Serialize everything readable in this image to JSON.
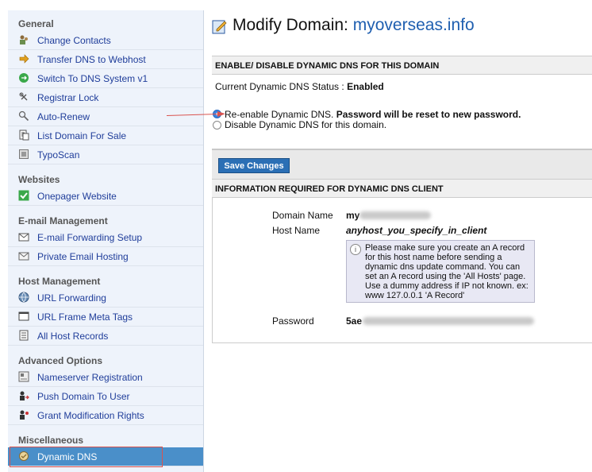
{
  "sidebar": {
    "sections": [
      {
        "title": "General",
        "items": [
          {
            "label": "Change Contacts",
            "icon": "contacts-icon"
          },
          {
            "label": "Transfer DNS to Webhost",
            "icon": "arrow-right-icon"
          },
          {
            "label": "Switch To DNS System v1",
            "icon": "switch-icon"
          },
          {
            "label": "Registrar Lock",
            "icon": "lock-icon"
          },
          {
            "label": "Auto-Renew",
            "icon": "renew-icon"
          },
          {
            "label": "List Domain For Sale",
            "icon": "list-icon"
          },
          {
            "label": "TypoScan",
            "icon": "scan-icon"
          }
        ]
      },
      {
        "title": "Websites",
        "items": [
          {
            "label": "Onepager Website",
            "icon": "checkmark-icon"
          }
        ]
      },
      {
        "title": "E-mail Management",
        "items": [
          {
            "label": "E-mail Forwarding Setup",
            "icon": "email-forward-icon"
          },
          {
            "label": "Private Email Hosting",
            "icon": "envelope-icon"
          }
        ]
      },
      {
        "title": "Host Management",
        "items": [
          {
            "label": "URL Forwarding",
            "icon": "globe-icon"
          },
          {
            "label": "URL Frame Meta Tags",
            "icon": "frame-icon"
          },
          {
            "label": "All Host Records",
            "icon": "host-records-icon"
          }
        ]
      },
      {
        "title": "Advanced Options",
        "items": [
          {
            "label": "Nameserver Registration",
            "icon": "nameserver-icon"
          },
          {
            "label": "Push Domain To User",
            "icon": "push-icon"
          },
          {
            "label": "Grant Modification Rights",
            "icon": "grant-icon"
          }
        ]
      },
      {
        "title": "Miscellaneous",
        "items": [
          {
            "label": "Dynamic DNS",
            "icon": "dynamic-dns-icon",
            "active": true
          }
        ]
      }
    ]
  },
  "main": {
    "title_prefix": "Modify Domain:",
    "title_domain": "myoverseas.info",
    "enable_section": {
      "header": "ENABLE/ DISABLE DYNAMIC DNS FOR THIS DOMAIN",
      "status_label": "Current Dynamic DNS Status :",
      "status_value": "Enabled",
      "option_reenable": "Re-enable Dynamic DNS.",
      "option_reenable_note": "Password will be reset to new password.",
      "option_disable": "Disable Dynamic DNS for this domain."
    },
    "save_button": "Save Changes",
    "info_section": {
      "header": "INFORMATION REQUIRED FOR DYNAMIC DNS CLIENT",
      "domain_label": "Domain Name",
      "domain_value": "my",
      "host_label": "Host Name",
      "host_value": "anyhost_you_specify_in_client",
      "note": "Please make sure you create an A record for this host name before sending a dynamic dns update command. You can set an A record using the 'All Hosts' page. Use a dummy address if IP not known. ex: www 127.0.0.1 'A Record'",
      "password_label": "Password",
      "password_value": "5ae"
    }
  },
  "colors": {
    "accent": "#1f5fb0",
    "active_item": "#4a8fc9",
    "highlight": "#d9534f",
    "save_button": "#2b6fb5"
  }
}
